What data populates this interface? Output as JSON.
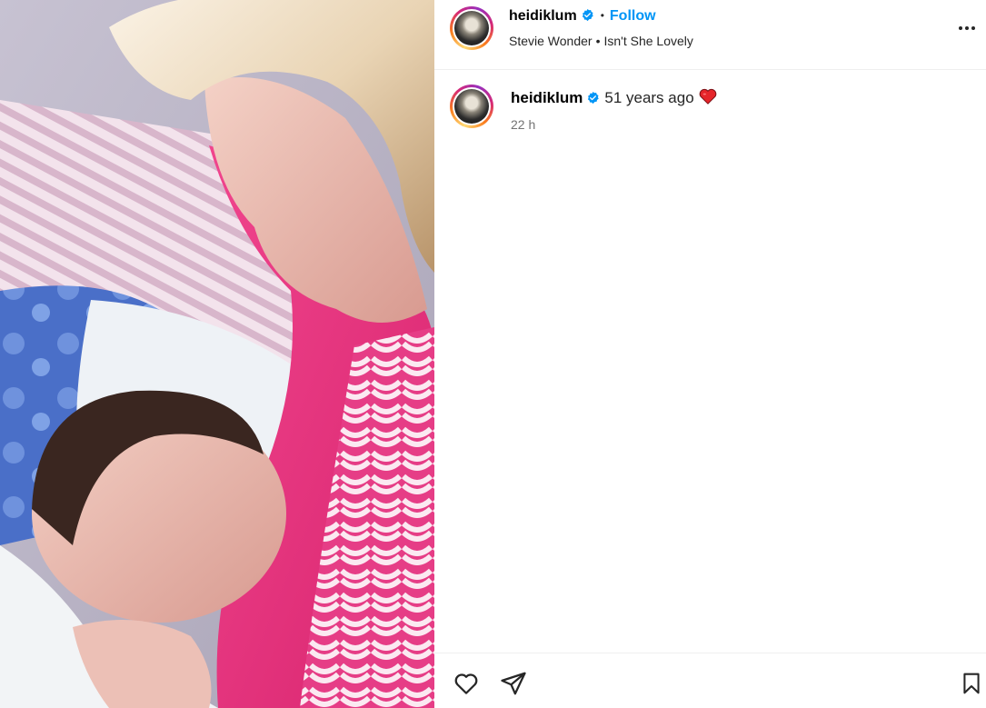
{
  "post": {
    "media_alt": "Photo of a mother nursing a newborn baby",
    "header": {
      "username": "heidiklum",
      "verified": true,
      "separator": "•",
      "follow_label": "Follow",
      "audio_artist": "Stevie Wonder",
      "audio_separator": "•",
      "audio_title": "Isn't She Lovely",
      "more_icon": "more-horizontal-icon"
    },
    "caption": {
      "username": "heidiklum",
      "verified": true,
      "text": "51 years ago",
      "emoji": "red-heart",
      "time": "22 h"
    },
    "actions": {
      "like_icon": "heart-outline-icon",
      "share_icon": "paper-plane-icon",
      "save_icon": "bookmark-icon"
    }
  },
  "colors": {
    "accent": "#0095f6",
    "text": "#262626",
    "muted": "#737373",
    "divider": "#efefef",
    "verified": "#0095f6"
  }
}
